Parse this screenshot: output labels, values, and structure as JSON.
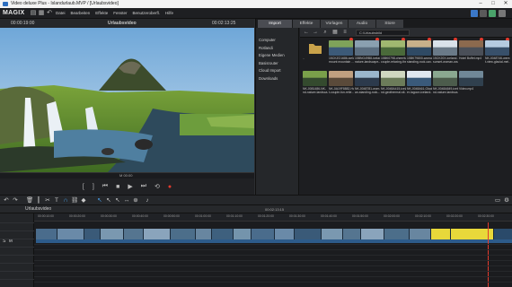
{
  "window": {
    "title": "Video deluxe Plus - Islandurlaub.MVP / [Urlaubsvideo]",
    "controls": [
      "–",
      "□",
      "✕"
    ]
  },
  "menubar": {
    "logo": "MAGIX",
    "menus": [
      "Datei",
      "Bearbeiten",
      "Effekte",
      "Fenster",
      "Benutzeroberfl.",
      "Hilfe"
    ]
  },
  "preview": {
    "timecode_left": "00:00:19:00",
    "title": "Urlaubsvideo",
    "timecode_right": "00:02:13:25",
    "ruler_timecode": "M 00:00"
  },
  "mediapool": {
    "tabs": [
      "Import",
      "Effekte",
      "Vorlagen",
      "Audio",
      "Store"
    ],
    "active_tab": "Import",
    "folders": [
      "Computer",
      "Rotlandi",
      "Eigene Medien",
      "Basisrouter",
      "Cloud Import",
      "Downloads"
    ],
    "path": "C:\\Urlaubsbild",
    "items": [
      {
        "name": "..",
        "sub": "",
        "kind": "folder"
      },
      {
        "name": "15CKZG1686-iceland-",
        "sub": "mount mountain ...",
        "kind": "clip"
      },
      {
        "name": "15BNG49B8-iceland-",
        "sub": "nature-landscape-...",
        "kind": "clip"
      },
      {
        "name": "15BK0798-cheerful-",
        "sub": "couple-relaxing-the-...",
        "kind": "clip"
      },
      {
        "name": "15BK79800-woman-",
        "sub": "standing-rock-cav...",
        "kind": "clip"
      },
      {
        "name": "15CK20X-iceland-",
        "sub": "sunset-woman-wa...",
        "kind": "clip"
      },
      {
        "name": "Hotel Buffet.mp4",
        "sub": "",
        "kind": "clip"
      },
      {
        "name": "NK-0048746-were-",
        "sub": "t-view-glacial-mel...",
        "kind": "clip"
      },
      {
        "name": "NK-0081486-NK-",
        "sub": "nd-nature-landsca...",
        "kind": "clip"
      },
      {
        "name": "NK-0A19F8882-Ham-",
        "sub": "t-couple-fun-relie...",
        "kind": "clip"
      },
      {
        "name": "NK-0048781-wom-",
        "sub": "an-standing-rock-...",
        "kind": "clip"
      },
      {
        "name": "NK-0048A415-icela-",
        "sub": "nd-geothermal-sit...",
        "kind": "clip"
      },
      {
        "name": "NK-0048A61-Glaci-",
        "sub": "er-lagoon-iceland-",
        "kind": "clip"
      },
      {
        "name": "NK-0048A849-iceb-",
        "sub": "nd-nature-landsca...",
        "kind": "clip"
      },
      {
        "name": "Video.mp4",
        "sub": "",
        "kind": "clip"
      }
    ]
  },
  "timeline": {
    "project": "Urlaubsvideo",
    "timecode": "00:02:13:15",
    "track_buttons": "S M",
    "ruler_ticks": [
      "00:00:10:00",
      "00:00:20:00",
      "00:00:30:00",
      "00:00:40:00",
      "00:00:50:00",
      "00:01:00:00",
      "00:01:10:00",
      "00:01:20:00",
      "00:01:30:00",
      "00:01:40:00",
      "00:01:50:00",
      "00:02:00:00",
      "00:02:10:00",
      "00:02:20:00",
      "00:02:30:00"
    ]
  },
  "icons": {
    "play": "play-icon",
    "stop": "stop-icon",
    "record": "record-icon",
    "undo": "undo-icon",
    "redo": "redo-icon",
    "delete": "delete-icon",
    "cut": "cut-icon",
    "magnet": "magnet-icon",
    "folder": "folder-icon"
  },
  "colors": {
    "accent": "#e23b2e",
    "selection_clip": "#e8d83a",
    "clip_blue": "#2a4a6a",
    "audio_blue": "#2d5b8a"
  }
}
